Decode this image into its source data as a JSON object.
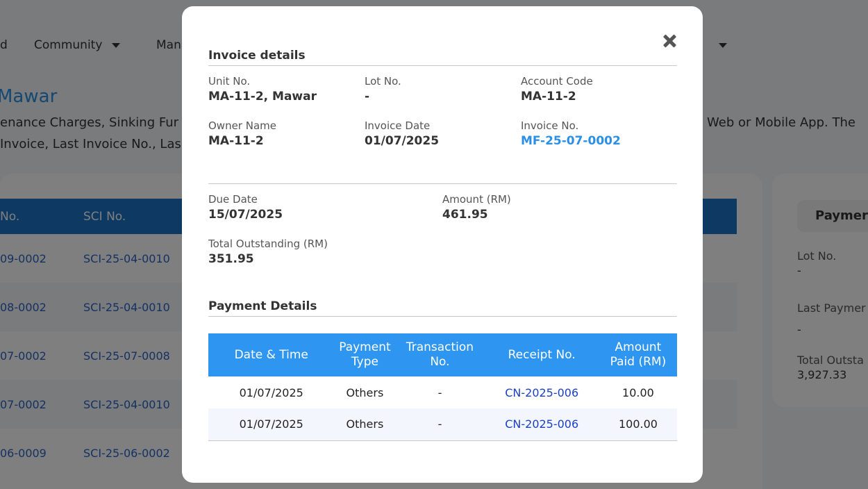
{
  "background": {
    "nav": [
      {
        "label": "d",
        "has_caret": false
      },
      {
        "label": "Community",
        "has_caret": true
      },
      {
        "label": "Man",
        "has_caret": false
      }
    ],
    "title": "Mawar",
    "desc_line1_left": "enance Charges, Sinking Fur",
    "desc_line1_right": "Web or Mobile App. The",
    "desc_line2_left": "Invoice, Last Invoice No., Las",
    "table_headers": [
      "No.",
      "SCI No."
    ],
    "rows": [
      {
        "invoice": "09-0002",
        "sci": "SCI-25-04-0010"
      },
      {
        "invoice": "08-0002",
        "sci": "SCI-25-04-0010"
      },
      {
        "invoice": "07-0002",
        "sci": "SCI-25-07-0008"
      },
      {
        "invoice": "07-0002",
        "sci": "SCI-25-04-0010"
      },
      {
        "invoice": "06-0009",
        "sci": "SCI-25-06-0002"
      }
    ],
    "right_panel": {
      "title": "Paymer",
      "lot_label": "Lot No.",
      "lot_value": "-",
      "last_payment_label": "Last Paymer",
      "last_payment_value": "-",
      "total_label": "Total Outsta",
      "total_value": "3,927.33"
    }
  },
  "modal": {
    "invoice_title": "Invoice details",
    "unit_label": "Unit No.",
    "unit_value": "MA-11-2, Mawar",
    "lot_label": "Lot No.",
    "lot_value": "-",
    "account_label": "Account Code",
    "account_value": "MA-11-2",
    "owner_label": "Owner Name",
    "owner_value": "MA-11-2",
    "invoice_date_label": "Invoice Date",
    "invoice_date_value": "01/07/2025",
    "invoice_no_label": "Invoice No.",
    "invoice_no_value": "MF-25-07-0002",
    "due_label": "Due Date",
    "due_value": "15/07/2025",
    "amount_label": "Amount (RM)",
    "amount_value": "461.95",
    "outstanding_label": "Total Outstanding (RM)",
    "outstanding_value": "351.95",
    "payment_title": "Payment Details",
    "columns": [
      "Date & Time",
      "Payment Type",
      "Transaction No.",
      "Receipt No.",
      "Amount Paid (RM)"
    ],
    "payments": [
      {
        "date": "01/07/2025",
        "type": "Others",
        "txn": "-",
        "receipt": "CN-2025-006",
        "amount": "10.00"
      },
      {
        "date": "01/07/2025",
        "type": "Others",
        "txn": "-",
        "receipt": "CN-2025-006",
        "amount": "100.00"
      }
    ]
  }
}
